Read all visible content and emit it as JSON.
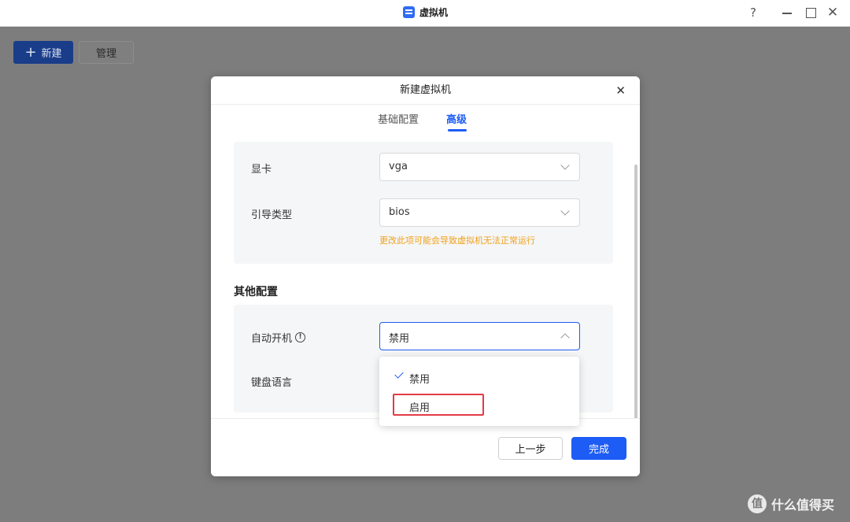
{
  "window": {
    "title": "虚拟机",
    "help_glyph": "?",
    "close_glyph": "✕"
  },
  "toolbar": {
    "new_label": "新建",
    "new_glyph": "+",
    "manage_label": "管理"
  },
  "dialog": {
    "title": "新建虚拟机",
    "close_glyph": "✕",
    "tabs": [
      {
        "label": "基础配置",
        "active": false
      },
      {
        "label": "高级",
        "active": true
      }
    ],
    "fields": {
      "gpu": {
        "label": "显卡",
        "value": "vga"
      },
      "boot_type": {
        "label": "引导类型",
        "value": "bios",
        "warning": "更改此项可能会导致虚拟机无法正常运行"
      }
    },
    "other_section_title": "其他配置",
    "auto_start": {
      "label": "自动开机",
      "info_glyph": "!",
      "value": "禁用",
      "options": [
        {
          "label": "禁用",
          "selected": true
        },
        {
          "label": "启用",
          "selected": false,
          "highlighted": true
        }
      ]
    },
    "keyboard": {
      "label": "键盘语言"
    },
    "buttons": {
      "prev": "上一步",
      "done": "完成"
    }
  },
  "watermark": {
    "logo_glyph": "值",
    "text": "什么值得买"
  },
  "colors": {
    "accent": "#1d5cf5",
    "warning": "#f0a11c",
    "highlight_border": "#e23b46"
  }
}
